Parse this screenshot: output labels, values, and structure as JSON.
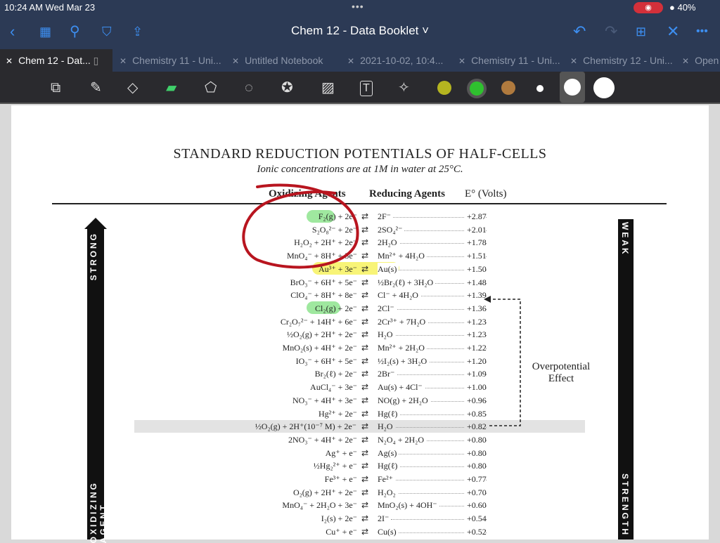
{
  "status": {
    "time": "10:24 AM  Wed Mar 23",
    "battery": "● 40%"
  },
  "nav": {
    "title": "Chem 12 - Data Booklet ˅",
    "left_icons": [
      "back-icon",
      "grid-icon",
      "search-icon",
      "bookmark-icon",
      "share-icon"
    ],
    "right_icons": [
      "undo-icon",
      "redo-icon",
      "add-page-icon",
      "close-icon",
      "more-icon"
    ]
  },
  "tabs": [
    {
      "label": "Chem 12 - Dat...",
      "active": true
    },
    {
      "label": "Chemistry 11 - Uni..."
    },
    {
      "label": "Untitled Notebook"
    },
    {
      "label": "2021-10-02, 10:4..."
    },
    {
      "label": "Chemistry 11 - Uni..."
    },
    {
      "label": "Chemistry 12 - Uni..."
    },
    {
      "label": "Open"
    }
  ],
  "toolbar": {
    "tools": [
      "page-view-icon",
      "pen-icon",
      "eraser-icon",
      "highlighter-icon",
      "shapes-icon",
      "lasso-icon",
      "sticker-icon",
      "image-icon",
      "text-icon",
      "laser-pointer-icon"
    ],
    "colors": [
      "#b5b520",
      "#2fc12f",
      "#b07a3e"
    ],
    "selected_color": "#2fc12f"
  },
  "doc": {
    "title": "STANDARD REDUCTION POTENTIALS OF HALF-CELLS",
    "subtitle": "Ionic concentrations are at 1M in water at 25°C.",
    "col_ox": "Oxidizing Agents",
    "col_red": "Reducing Agents",
    "col_e": "E° (Volts)",
    "left_label_top": "STRONG",
    "left_label_bottom": "OXIDIZING AGENT",
    "right_label_top": "WEAK",
    "right_label_bottom": "STRENGTH",
    "annotation": "Overpotential Effect",
    "arrow_symbol": "⇄",
    "rows": [
      {
        "ox": "F₂(g) + 2e⁻",
        "red": "2F⁻",
        "e": "+2.87"
      },
      {
        "ox": "S₂O₈²⁻ + 2e⁻",
        "red": "2SO₄²⁻",
        "e": "+2.01"
      },
      {
        "ox": "H₂O₂ + 2H⁺ + 2e⁻",
        "red": "2H₂O",
        "e": "+1.78"
      },
      {
        "ox": "MnO₄⁻ + 8H⁺ + 5e⁻",
        "red": "Mn²⁺ + 4H₂O",
        "e": "+1.51"
      },
      {
        "ox": "Au³⁺ + 3e⁻",
        "red": "Au(s)",
        "e": "+1.50"
      },
      {
        "ox": "BrO₃⁻ + 6H⁺ + 5e⁻",
        "red": "½Br₂(ℓ) + 3H₂O",
        "e": "+1.48"
      },
      {
        "ox": "ClO₄⁻ + 8H⁺ + 8e⁻",
        "red": "Cl⁻ + 4H₂O",
        "e": "+1.39"
      },
      {
        "ox": "Cl₂(g) + 2e⁻",
        "red": "2Cl⁻",
        "e": "+1.36"
      },
      {
        "ox": "Cr₂O₇²⁻ + 14H⁺ + 6e⁻",
        "red": "2Cr³⁺ + 7H₂O",
        "e": "+1.23"
      },
      {
        "ox": "½O₂(g) + 2H⁺ + 2e⁻",
        "red": "H₂O",
        "e": "+1.23"
      },
      {
        "ox": "MnO₂(s) + 4H⁺ + 2e⁻",
        "red": "Mn²⁺ + 2H₂O",
        "e": "+1.22"
      },
      {
        "ox": "IO₃⁻ + 6H⁺ + 5e⁻",
        "red": "½I₂(s) + 3H₂O",
        "e": "+1.20"
      },
      {
        "ox": "Br₂(ℓ) + 2e⁻",
        "red": "2Br⁻",
        "e": "+1.09"
      },
      {
        "ox": "AuCl₄⁻ + 3e⁻",
        "red": "Au(s) + 4Cl⁻",
        "e": "+1.00"
      },
      {
        "ox": "NO₃⁻ + 4H⁺ + 3e⁻",
        "red": "NO(g) + 2H₂O",
        "e": "+0.96"
      },
      {
        "ox": "Hg²⁺ + 2e⁻",
        "red": "Hg(ℓ)",
        "e": "+0.85"
      },
      {
        "ox": "½O₂(g) + 2H⁺(10⁻⁷ M) + 2e⁻",
        "red": "H₂O",
        "e": "+0.82",
        "highlight": true
      },
      {
        "ox": "2NO₃⁻ + 4H⁺ + 2e⁻",
        "red": "N₂O₄ + 2H₂O",
        "e": "+0.80"
      },
      {
        "ox": "Ag⁺ + e⁻",
        "red": "Ag(s)",
        "e": "+0.80"
      },
      {
        "ox": "½Hg₂²⁺ + e⁻",
        "red": "Hg(ℓ)",
        "e": "+0.80"
      },
      {
        "ox": "Fe³⁺ + e⁻",
        "red": "Fe²⁺",
        "e": "+0.77"
      },
      {
        "ox": "O₂(g) + 2H⁺ + 2e⁻",
        "red": "H₂O₂",
        "e": "+0.70"
      },
      {
        "ox": "MnO₄⁻ + 2H₂O + 3e⁻",
        "red": "MnO₂(s) + 4OH⁻",
        "e": "+0.60"
      },
      {
        "ox": "I₂(s) + 2e⁻",
        "red": "2I⁻",
        "e": "+0.54"
      },
      {
        "ox": "Cu⁺ + e⁻",
        "red": "Cu(s)",
        "e": "+0.52"
      }
    ]
  }
}
